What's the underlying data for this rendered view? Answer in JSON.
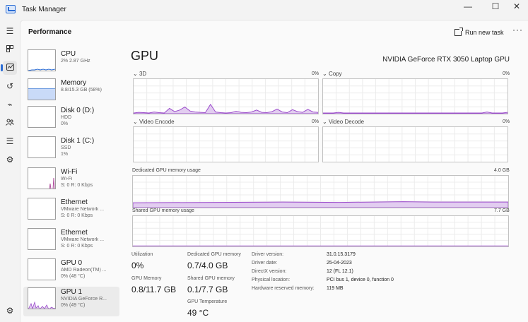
{
  "window": {
    "title": "Task Manager",
    "minimize": "—",
    "maximize": "☐",
    "close": "✕"
  },
  "header": {
    "title": "Performance",
    "run_task": "Run new task",
    "more": "···"
  },
  "devices": [
    {
      "name": "CPU",
      "sub1": "2% 2.87 GHz",
      "sub2": ""
    },
    {
      "name": "Memory",
      "sub1": "8.8/15.3 GB (58%)",
      "sub2": ""
    },
    {
      "name": "Disk 0 (D:)",
      "sub1": "HDD",
      "sub2": "0%"
    },
    {
      "name": "Disk 1 (C:)",
      "sub1": "SSD",
      "sub2": "1%"
    },
    {
      "name": "Wi-Fi",
      "sub1": "Wi-Fi",
      "sub2": "S: 0 R: 0 Kbps"
    },
    {
      "name": "Ethernet",
      "sub1": "VMware Network ...",
      "sub2": "S: 0 R: 0 Kbps"
    },
    {
      "name": "Ethernet",
      "sub1": "VMware Network ...",
      "sub2": "S: 0 R: 0 Kbps"
    },
    {
      "name": "GPU 0",
      "sub1": "AMD Radeon(TM) ...",
      "sub2": "0% (48 °C)"
    },
    {
      "name": "GPU 1",
      "sub1": "NVIDIA GeForce R...",
      "sub2": "0% (49 °C)"
    }
  ],
  "gpu": {
    "title": "GPU",
    "model": "NVIDIA GeForce RTX 3050 Laptop GPU",
    "engines": [
      {
        "label": "3D",
        "pct": "0%"
      },
      {
        "label": "Copy",
        "pct": "0%"
      },
      {
        "label": "Video Encode",
        "pct": "0%"
      },
      {
        "label": "Video Decode",
        "pct": "0%"
      }
    ],
    "dedicated": {
      "label": "Dedicated GPU memory usage",
      "max": "4.0 GB"
    },
    "shared": {
      "label": "Shared GPU memory usage",
      "max": "7.7 GB"
    },
    "stats": {
      "utilization_label": "Utilization",
      "utilization": "0%",
      "gpu_memory_label": "GPU Memory",
      "gpu_memory": "0.8/11.7 GB",
      "dedicated_label": "Dedicated GPU memory",
      "dedicated": "0.7/4.0 GB",
      "shared_label": "Shared GPU memory",
      "shared": "0.1/7.7 GB",
      "temp_label": "GPU Temperature",
      "temp": "49 °C"
    },
    "info": [
      {
        "k": "Driver version:",
        "v": "31.0.15.3179"
      },
      {
        "k": "Driver date:",
        "v": "25-04-2023"
      },
      {
        "k": "DirectX version:",
        "v": "12 (FL 12.1)"
      },
      {
        "k": "Physical location:",
        "v": "PCI bus 1, device 0, function 0"
      },
      {
        "k": "Hardware reserved memory:",
        "v": "119 MB"
      }
    ],
    "graph_3d_values": [
      0,
      2,
      1,
      0,
      3,
      1,
      0,
      14,
      4,
      9,
      18,
      6,
      3,
      2,
      1,
      26,
      3,
      1,
      0,
      1,
      5,
      2,
      1,
      3,
      9,
      2,
      1,
      4,
      12,
      3,
      1,
      10,
      4,
      2,
      11,
      3,
      2
    ],
    "graph_copy_values": [
      0,
      0,
      0,
      2,
      0,
      0,
      0,
      0,
      0,
      0,
      0,
      0,
      0,
      0,
      0,
      0,
      0,
      0,
      0,
      0,
      0,
      0,
      0,
      0,
      0,
      0,
      0,
      0,
      0,
      0,
      0,
      0,
      3,
      0,
      0,
      0,
      2
    ]
  },
  "colors": {
    "accent": "#2b6cd4",
    "gpu_line": "#9c4dcc",
    "gpu_fill": "#e2cdf0",
    "memory_fill": "#c9daf8"
  },
  "icons": {
    "hamburger": "hamburger-icon",
    "performance": "performance-icon",
    "history": "history-icon",
    "startup": "startup-icon",
    "users": "users-icon",
    "services": "services-icon",
    "settings": "settings-icon"
  }
}
